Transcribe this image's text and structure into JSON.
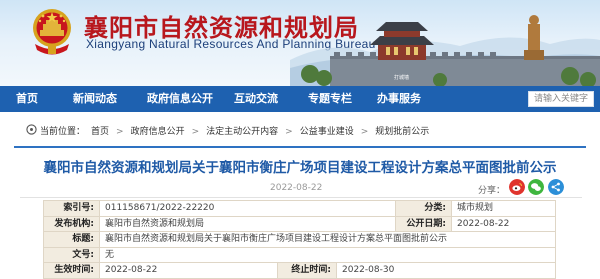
{
  "header": {
    "title": "襄阳市自然资源和规划局",
    "subtitle": "Xiangyang Natural Resources And Planning Bureau",
    "badge_text": "打城墙"
  },
  "nav": {
    "items": [
      "首页",
      "新闻动态",
      "政府信息公开",
      "互动交流",
      "专题专栏",
      "办事服务"
    ],
    "search_placeholder": "请输入关键字"
  },
  "breadcrumb": {
    "prefix": "当前位置：",
    "items": [
      "首页",
      "政府信息公开",
      "法定主动公开内容",
      "公益事业建设",
      "规划批前公示"
    ]
  },
  "article": {
    "title": "襄阳市自然资源和规划局关于襄阳市衡庄广场项目建设工程设计方案总平面图批前公示",
    "date": "2022-08-22",
    "share_label": "分享：",
    "share_icons": [
      "weibo-icon",
      "wechat-icon",
      "more-share-icon"
    ]
  },
  "info": {
    "rows": [
      {
        "k1": "索引号:",
        "v1": "011158671/2022-22220",
        "k2": "分类:",
        "v2": "城市规划"
      },
      {
        "k1": "发布机构:",
        "v1": "襄阳市自然资源和规划局",
        "k2": "公开日期:",
        "v2": "2022-08-22"
      },
      {
        "k1": "标题:",
        "v1": "襄阳市自然资源和规划局关于襄阳市衡庄广场项目建设工程设计方案总平面图批前公示"
      },
      {
        "k1": "文号:",
        "v1": "无"
      },
      {
        "k1": "生效时间:",
        "v1": "2022-08-22",
        "k2": "终止时间:",
        "v2": "2022-08-30"
      }
    ]
  },
  "colors": {
    "brand_red": "#b8171d",
    "nav_blue": "#1e61b0",
    "title_blue": "#1f5aa6",
    "table_key_bg": "#f2ece0"
  }
}
